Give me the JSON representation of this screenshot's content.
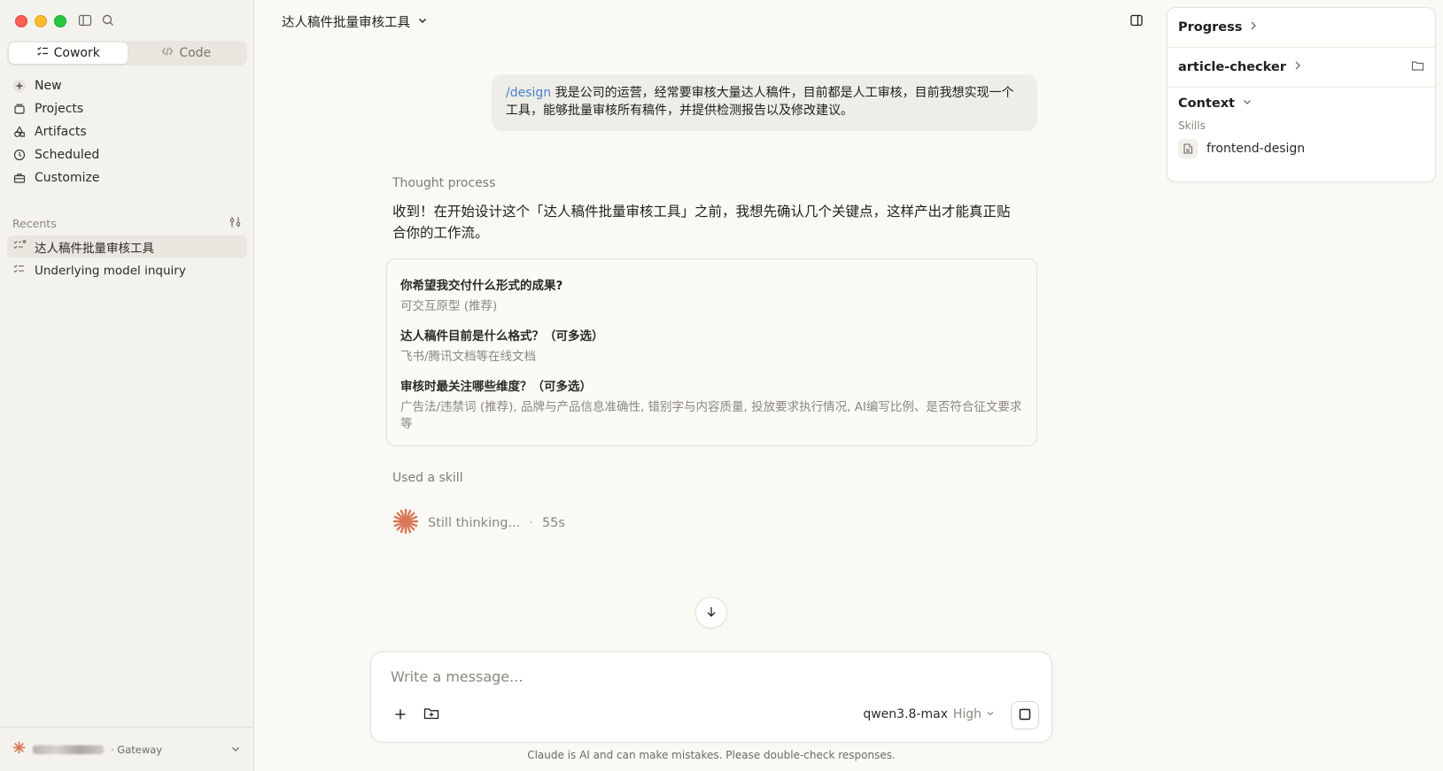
{
  "sidebar": {
    "modes": [
      {
        "label": "Cowork",
        "icon": "checklist-icon",
        "active": true
      },
      {
        "label": "Code",
        "icon": "code-icon",
        "active": false
      }
    ],
    "nav": [
      {
        "label": "New",
        "icon": "plus-icon"
      },
      {
        "label": "Projects",
        "icon": "folder-icon"
      },
      {
        "label": "Artifacts",
        "icon": "shapes-icon"
      },
      {
        "label": "Scheduled",
        "icon": "clock-icon"
      },
      {
        "label": "Customize",
        "icon": "briefcase-icon"
      }
    ],
    "recents_label": "Recents",
    "recents": [
      {
        "label": "达人稿件批量审核工具",
        "active": true
      },
      {
        "label": "Underlying model inquiry",
        "active": false
      }
    ],
    "user": {
      "gateway": "· Gateway"
    }
  },
  "header": {
    "title": "达人稿件批量审核工具"
  },
  "right_panel": {
    "progress": "Progress",
    "project": "article-checker",
    "context": "Context",
    "skills_label": "Skills",
    "skills": [
      "frontend-design"
    ]
  },
  "conversation": {
    "user_message": {
      "command": "/design",
      "text": " 我是公司的运营，经常要审核大量达人稿件，目前都是人工审核，目前我想实现一个工具，能够批量审核所有稿件，并提供检测报告以及修改建议。"
    },
    "thought_label": "Thought process",
    "assistant_text": "收到！在开始设计这个「达人稿件批量审核工具」之前，我想先确认几个关键点，这样产出才能真正贴合你的工作流。",
    "questions": [
      {
        "q": "你希望我交付什么形式的成果?",
        "a": "可交互原型 (推荐)"
      },
      {
        "q": "达人稿件目前是什么格式？（可多选）",
        "a": "飞书/腾讯文档等在线文档"
      },
      {
        "q": "审核时最关注哪些维度？（可多选）",
        "a": "广告法/违禁词 (推荐), 品牌与产品信息准确性, 错别字与内容质量, 投放要求执行情况, AI编写比例、是否符合征文要求等"
      }
    ],
    "used_skill": "Used a skill",
    "thinking": "Still thinking...",
    "thinking_sep": "·",
    "elapsed": "55s"
  },
  "composer": {
    "placeholder": "Write a message...",
    "model": "qwen3.8-max",
    "effort": "High"
  },
  "disclaimer": "Claude is AI and can make mistakes. Please double-check responses.",
  "colors": {
    "accent": "#d97757",
    "link": "#4b7fcc",
    "background": "#faf9f5",
    "sidebar": "#f4f2ed"
  }
}
